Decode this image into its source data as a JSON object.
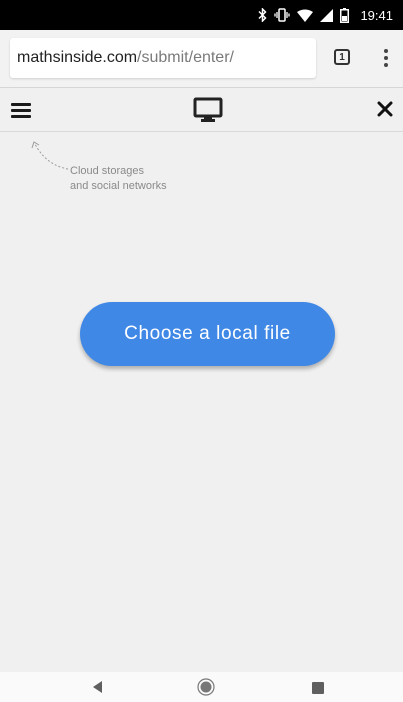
{
  "status_bar": {
    "time": "19:41",
    "icons": [
      "bluetooth-icon",
      "vibrate-icon",
      "wifi-icon",
      "signal-icon",
      "battery-icon"
    ]
  },
  "browser": {
    "url_host": "mathsinside.com",
    "url_path": "/submit/enter/",
    "tab_count": "1",
    "menu_icon": "overflow-menu-icon"
  },
  "toolbar": {
    "left_icon": "hamburger-menu-icon",
    "center_icon": "desktop-monitor-icon",
    "right_icon": "close-icon"
  },
  "hint": {
    "line1": "Cloud storages",
    "line2": "and social networks",
    "icon": "dashed-arrow-icon"
  },
  "main": {
    "choose_file_label": "Choose a local file",
    "button_color": "#3f88e6"
  },
  "nav_bar": {
    "icons": [
      "back-icon",
      "home-icon",
      "recents-icon"
    ]
  }
}
